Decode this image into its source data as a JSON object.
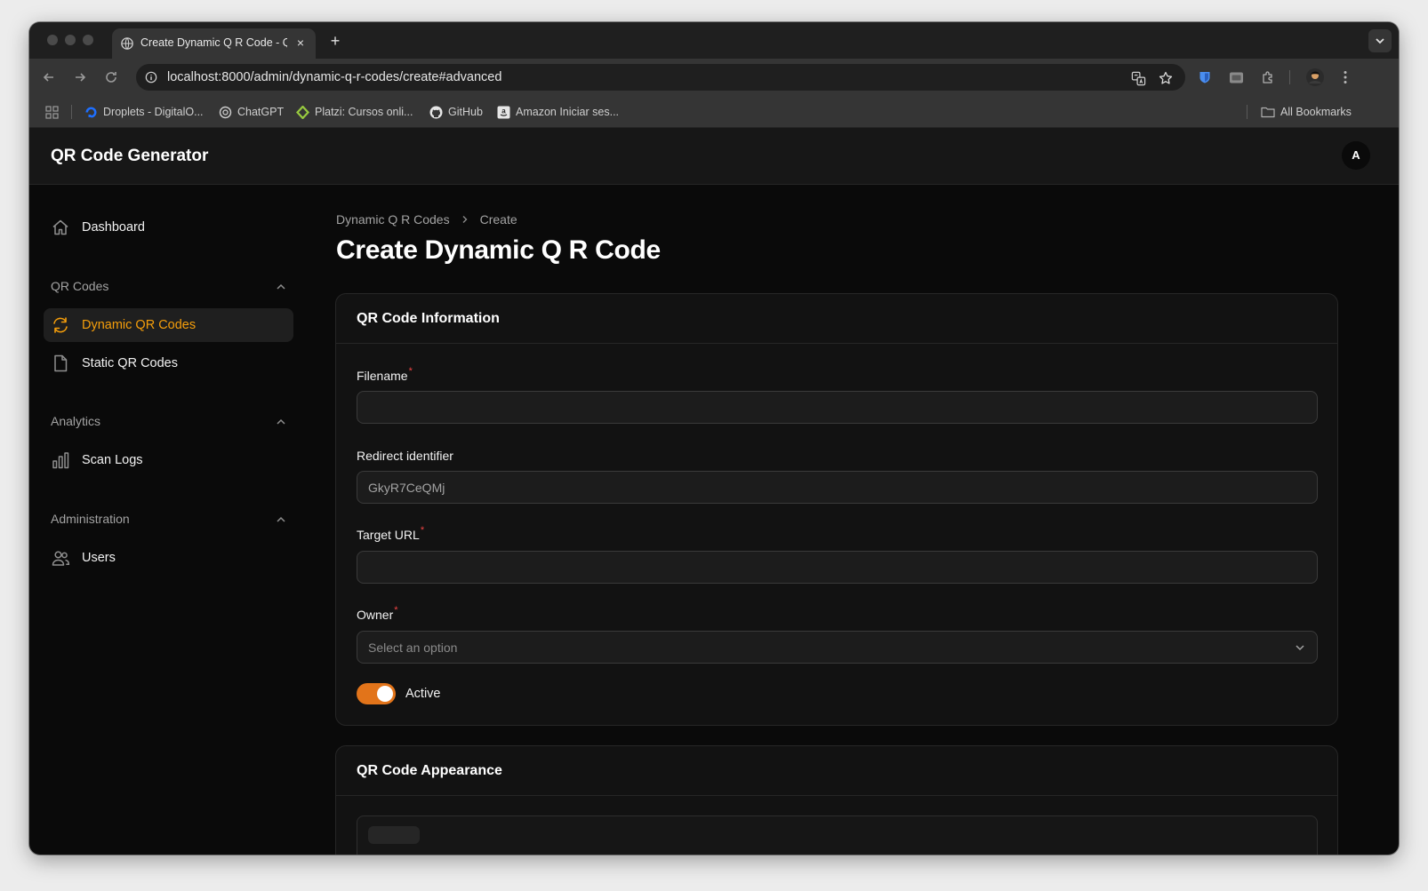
{
  "browser": {
    "tab_title": "Create Dynamic Q R Code - QR Code Generator",
    "tab_close": "×",
    "new_tab": "+",
    "url": "localhost:8000/admin/dynamic-q-r-codes/create#advanced",
    "bookmarks": [
      {
        "label": "Droplets - DigitalO...",
        "icon": "digitalocean-icon",
        "color": "#1e6fff"
      },
      {
        "label": "ChatGPT",
        "icon": "chatgpt-icon",
        "color": "#cfcfcf"
      },
      {
        "label": "Platzi: Cursos onli...",
        "icon": "platzi-icon",
        "color": "#98ca3f"
      },
      {
        "label": "GitHub",
        "icon": "github-icon",
        "color": "#e6e6e6"
      },
      {
        "label": "Amazon Iniciar ses...",
        "icon": "amazon-icon",
        "color": "#e6e6e6"
      }
    ],
    "all_bookmarks": "All Bookmarks"
  },
  "app": {
    "brand": "QR Code Generator",
    "avatar_initial": "A",
    "accent_color": "#f59e0b"
  },
  "sidebar": {
    "dashboard": {
      "label": "Dashboard",
      "icon": "home-icon"
    },
    "groups": [
      {
        "label": "QR Codes",
        "items": [
          {
            "label": "Dynamic QR Codes",
            "icon": "refresh-icon",
            "active": true
          },
          {
            "label": "Static QR Codes",
            "icon": "document-icon",
            "active": false
          }
        ]
      },
      {
        "label": "Analytics",
        "items": [
          {
            "label": "Scan Logs",
            "icon": "bar-chart-icon",
            "active": false
          }
        ]
      },
      {
        "label": "Administration",
        "items": [
          {
            "label": "Users",
            "icon": "users-icon",
            "active": false
          }
        ]
      }
    ]
  },
  "breadcrumb": {
    "parent": "Dynamic Q R Codes",
    "current": "Create"
  },
  "page_title": "Create Dynamic Q R Code",
  "info_section": {
    "title": "QR Code Information",
    "filename": {
      "label": "Filename",
      "required": "*",
      "value": ""
    },
    "redirect": {
      "label": "Redirect identifier",
      "value": "GkyR7CeQMj"
    },
    "target_url": {
      "label": "Target URL",
      "required": "*",
      "value": ""
    },
    "owner": {
      "label": "Owner",
      "required": "*",
      "placeholder": "Select an option"
    },
    "active": {
      "label": "Active",
      "on": true
    }
  },
  "appearance_section": {
    "title": "QR Code Appearance"
  }
}
